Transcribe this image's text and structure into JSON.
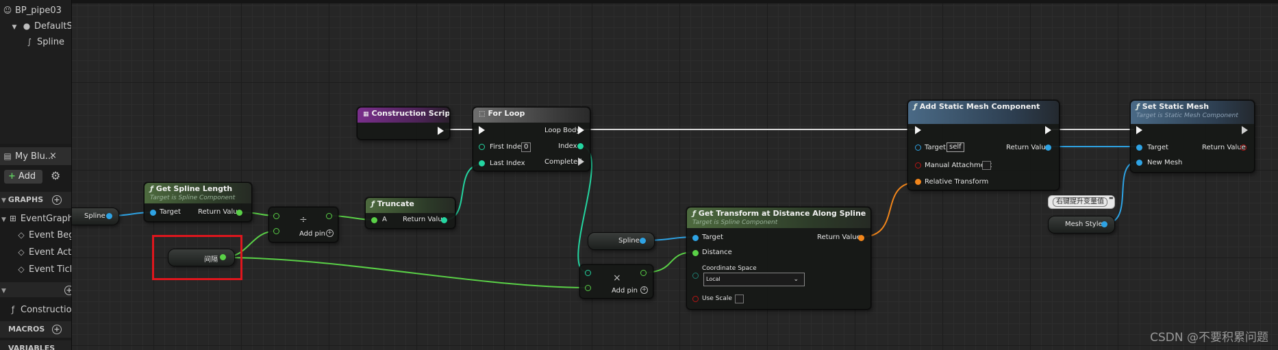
{
  "left_panel": {
    "blueprint_name": "BP_pipe03",
    "components": [
      "DefaultS",
      "Spline"
    ],
    "tab_title": "My Blu...",
    "close_glyph": "×",
    "add_label": "Add",
    "sections": {
      "graphs": "GRAPHS",
      "macros": "MACROS",
      "variables": "VARIABLES"
    },
    "graph_items": [
      "EventGraph",
      "Event Beg",
      "Event Act",
      "Event Ticl"
    ],
    "function_items": [
      "Constructio"
    ]
  },
  "graph": {
    "nodes": {
      "construction_script": {
        "title": "Construction Script"
      },
      "for_loop": {
        "title": "For Loop",
        "first_index_label": "First Index",
        "first_index_value": "0",
        "last_index_label": "Last Index",
        "loop_body_label": "Loop Body",
        "index_label": "Index",
        "completed_label": "Completed"
      },
      "spline_var_1": {
        "label": "Spline"
      },
      "get_spline_length": {
        "title": "Get Spline Length",
        "subtitle": "Target is Spline Component",
        "target_label": "Target",
        "return_label": "Return Value"
      },
      "divide": {
        "symbol": "÷",
        "add_pin_label": "Add pin"
      },
      "truncate": {
        "title": "Truncate",
        "a_label": "A",
        "return_label": "Return Value"
      },
      "interval_var": {
        "label": "间隔"
      },
      "spline_var_2": {
        "label": "Spline"
      },
      "multiply": {
        "symbol": "×",
        "add_pin_label": "Add pin"
      },
      "get_transform": {
        "title": "Get Transform at Distance Along Spline",
        "subtitle": "Target is Spline Component",
        "target_label": "Target",
        "distance_label": "Distance",
        "coord_space_label": "Coordinate Space",
        "coord_space_value": "Local",
        "use_scale_label": "Use Scale",
        "return_label": "Return Value"
      },
      "add_static_mesh": {
        "title": "Add Static Mesh Component",
        "target_label": "Target",
        "target_value": "self",
        "manual_attachment_label": "Manual Attachment",
        "relative_transform_label": "Relative Transform",
        "return_label": "Return Value"
      },
      "set_static_mesh": {
        "title": "Set Static Mesh",
        "subtitle": "Target is Static Mesh Component",
        "target_label": "Target",
        "new_mesh_label": "New Mesh",
        "return_label": "Return Value"
      },
      "mesh_style_var": {
        "label": "Mesh Style",
        "tooltip": "右键提升变量值"
      }
    },
    "highlight_color": "#e0161d",
    "pin_colors": {
      "exec": "#f4f4f4",
      "float": "#5ad147",
      "object": "#2ea3e4",
      "int": "#24d6a1",
      "transform": "#f2861b",
      "bool": "#b71515",
      "wire_exec": "#d9d9d9"
    }
  },
  "watermark": "CSDN @不要积累问题"
}
